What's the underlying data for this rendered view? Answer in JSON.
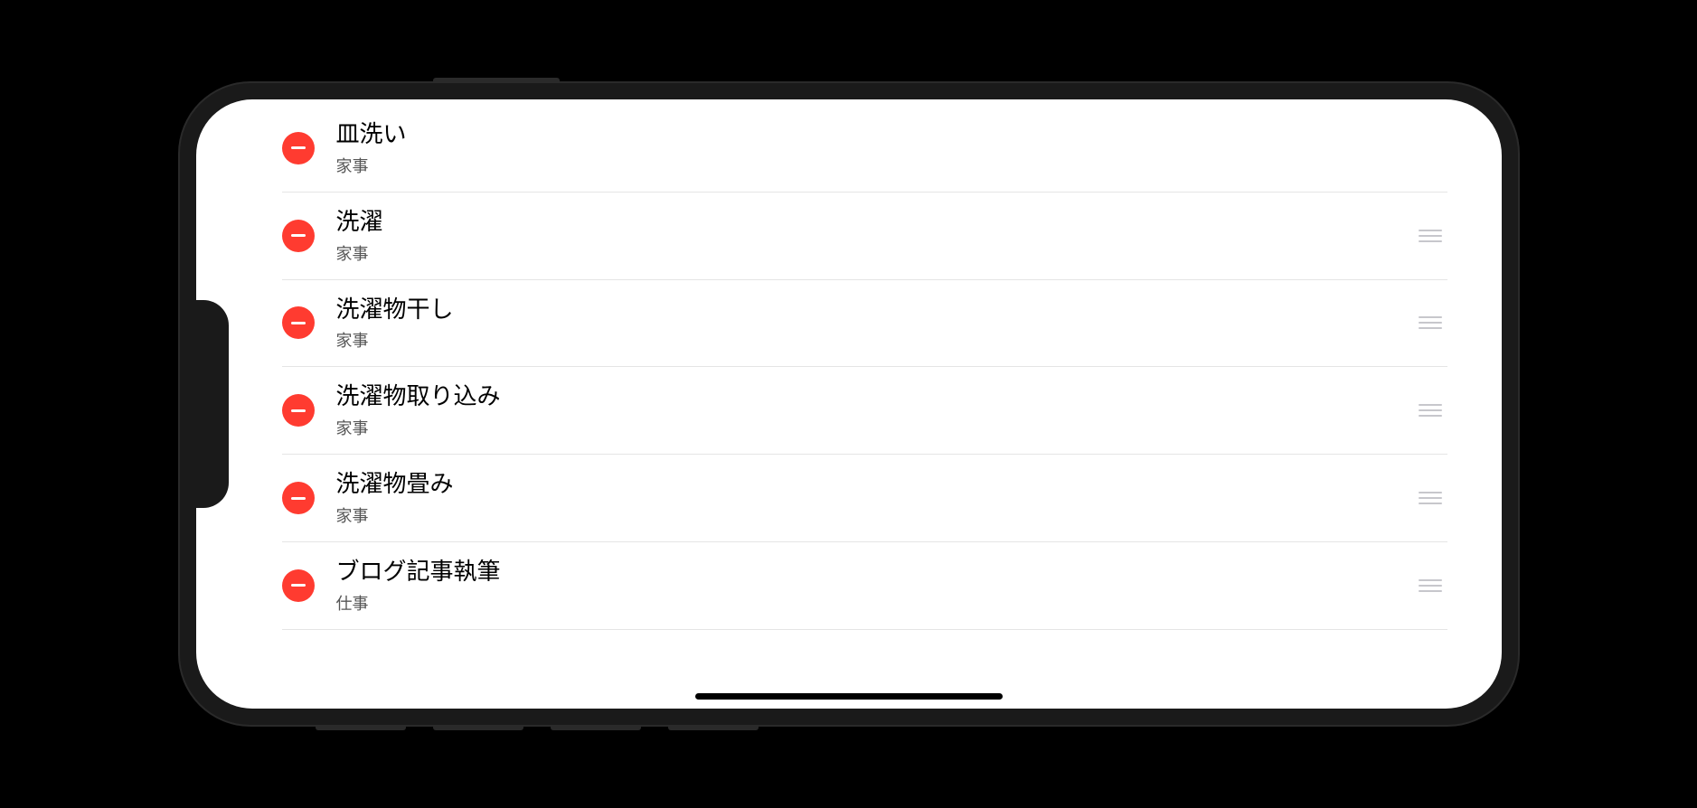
{
  "list": {
    "items": [
      {
        "title": "皿洗い",
        "category": "家事"
      },
      {
        "title": "洗濯",
        "category": "家事"
      },
      {
        "title": "洗濯物干し",
        "category": "家事"
      },
      {
        "title": "洗濯物取り込み",
        "category": "家事"
      },
      {
        "title": "洗濯物畳み",
        "category": "家事"
      },
      {
        "title": "ブログ記事執筆",
        "category": "仕事"
      }
    ]
  },
  "colors": {
    "delete_red": "#ff3b30",
    "background": "#ffffff",
    "frame": "#1a1a1a"
  }
}
